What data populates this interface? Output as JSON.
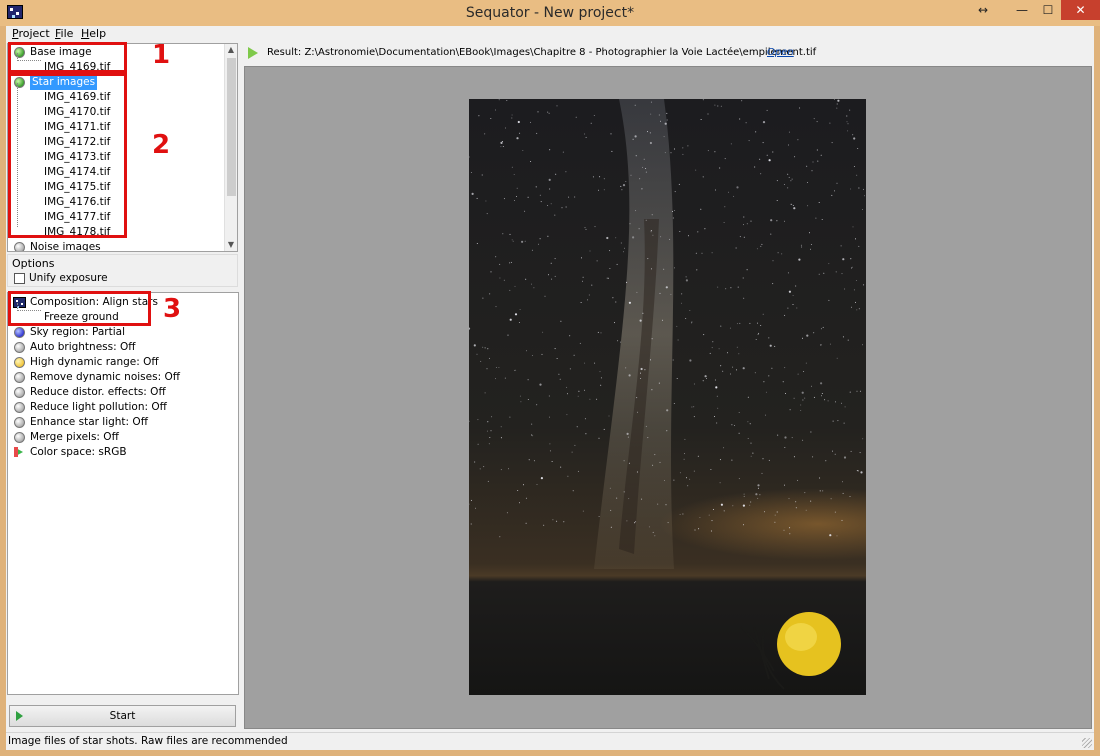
{
  "window": {
    "title": "Sequator - New project*",
    "controls": {
      "resize": "↔",
      "minimize": "—",
      "maximize": "☐",
      "close": "✕"
    }
  },
  "menu": [
    {
      "underline": "P",
      "rest": "roject"
    },
    {
      "underline": "F",
      "rest": "ile"
    },
    {
      "underline": "H",
      "rest": "elp"
    }
  ],
  "base_image": {
    "label": "Base image",
    "file": "IMG_4169.tif"
  },
  "star_images": {
    "label": "Star images",
    "files": [
      "IMG_4169.tif",
      "IMG_4170.tif",
      "IMG_4171.tif",
      "IMG_4172.tif",
      "IMG_4173.tif",
      "IMG_4174.tif",
      "IMG_4175.tif",
      "IMG_4176.tif",
      "IMG_4177.tif",
      "IMG_4178.tif"
    ]
  },
  "noise_images": {
    "label": "Noise images"
  },
  "options": {
    "title": "Options",
    "unify_exposure": {
      "label": "Unify exposure",
      "checked": false
    }
  },
  "settings": {
    "composition": "Composition: Align stars",
    "freeze_ground": "Freeze ground",
    "items": [
      {
        "label": "Sky region: Partial",
        "icon": "blue-ball-icon"
      },
      {
        "label": "Auto brightness: Off",
        "icon": "grey-ball-icon"
      },
      {
        "label": "High dynamic range: Off",
        "icon": "yellow-ball-icon"
      },
      {
        "label": "Remove dynamic noises: Off",
        "icon": "grey-ball-icon"
      },
      {
        "label": "Reduce distor. effects: Off",
        "icon": "grey-ball-icon"
      },
      {
        "label": "Reduce light pollution: Off",
        "icon": "grey-ball-icon"
      },
      {
        "label": "Enhance star light: Off",
        "icon": "grey-ball-icon"
      },
      {
        "label": "Merge pixels: Off",
        "icon": "grey-ball-icon"
      }
    ],
    "color_space": "Color space: sRGB"
  },
  "start_button": "Start",
  "result": {
    "text": "Result: Z:\\Astronomie\\Documentation\\EBook\\Images\\Chapitre 8 - Photographier la Voie Lactée\\empilement.tif",
    "open_link": "Open"
  },
  "status": "Image files of star shots. Raw files are recommended",
  "annotations": [
    "1",
    "2",
    "3"
  ],
  "colors": {
    "titlebar": "#e9bd83",
    "selection": "#3399ff",
    "marker": "#e01010",
    "close": "#c7402d"
  }
}
